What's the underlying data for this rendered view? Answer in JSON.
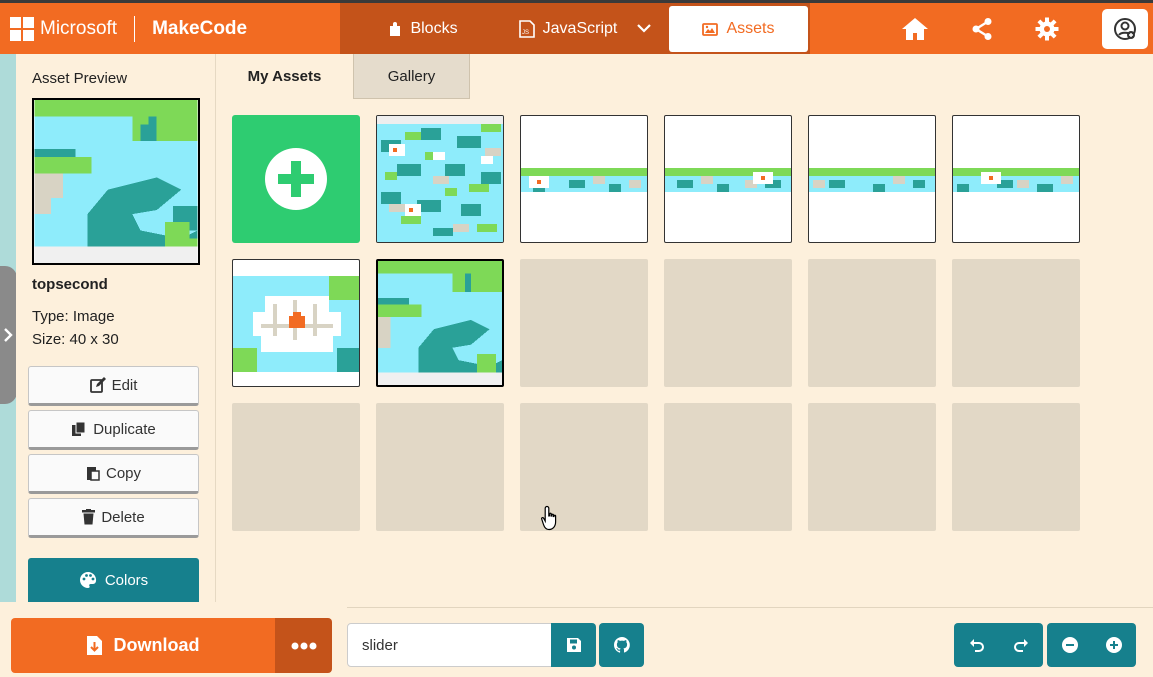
{
  "header": {
    "brand_company": "Microsoft",
    "brand_product": "MakeCode",
    "tabs": {
      "blocks": "Blocks",
      "javascript": "JavaScript",
      "assets": "Assets"
    },
    "icons": [
      "home-icon",
      "share-icon",
      "settings-gear-icon",
      "user-avatar-icon"
    ]
  },
  "sidebar": {
    "title": "Asset Preview",
    "asset_name": "topsecond",
    "asset_type": "Type: Image",
    "asset_size": "Size: 40 x 30",
    "buttons": {
      "edit": "Edit",
      "duplicate": "Duplicate",
      "copy": "Copy",
      "delete": "Delete",
      "colors": "Colors"
    }
  },
  "main": {
    "tabs": {
      "my_assets": "My Assets",
      "gallery": "Gallery"
    },
    "grid": {
      "total_cells": 18,
      "add_button_icon": "plus-circle-icon",
      "assets": [
        {
          "kind": "lily-pad-pattern"
        },
        {
          "kind": "lily-strip"
        },
        {
          "kind": "lily-strip"
        },
        {
          "kind": "lily-strip"
        },
        {
          "kind": "lily-strip"
        },
        {
          "kind": "lily-flower-closeup"
        },
        {
          "kind": "water-pads",
          "selected": true
        }
      ]
    }
  },
  "footer": {
    "download_label": "Download",
    "project_name": "slider",
    "icons": [
      "save-icon",
      "github-icon",
      "undo-icon",
      "redo-icon",
      "zoom-out-icon",
      "zoom-in-icon"
    ]
  },
  "colors": {
    "accent": "#f26b22",
    "accent_dark": "#c4531a",
    "teal": "#16808d",
    "add_green": "#2ecc71",
    "background": "#fdf0dc",
    "empty_cell": "#e2d8c6"
  }
}
